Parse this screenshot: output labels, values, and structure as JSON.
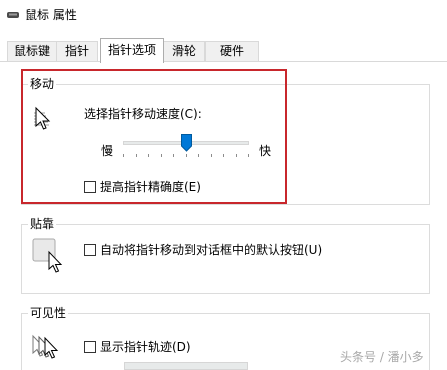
{
  "window": {
    "title": "鼠标 属性"
  },
  "tabs": [
    {
      "label": "鼠标键"
    },
    {
      "label": "指针"
    },
    {
      "label": "指针选项"
    },
    {
      "label": "滑轮"
    },
    {
      "label": "硬件"
    }
  ],
  "motion": {
    "legend": "移动",
    "speed_label": "选择指针移动速度(C):",
    "slow_label": "慢",
    "fast_label": "快",
    "speed_value_fraction": 0.5,
    "precision_label": "提高指针精确度(E)",
    "precision_checked": false
  },
  "snap": {
    "legend": "贴靠",
    "snap_label": "自动将指针移动到对话框中的默认按钮(U)",
    "snap_checked": false
  },
  "visibility": {
    "legend": "可见性",
    "trails_label": "显示指针轨迹(D)",
    "trails_checked": false
  },
  "watermark": "头条号 / 潘小多",
  "colors": {
    "highlight": "#c8272c",
    "slider_thumb": "#0078d7"
  }
}
